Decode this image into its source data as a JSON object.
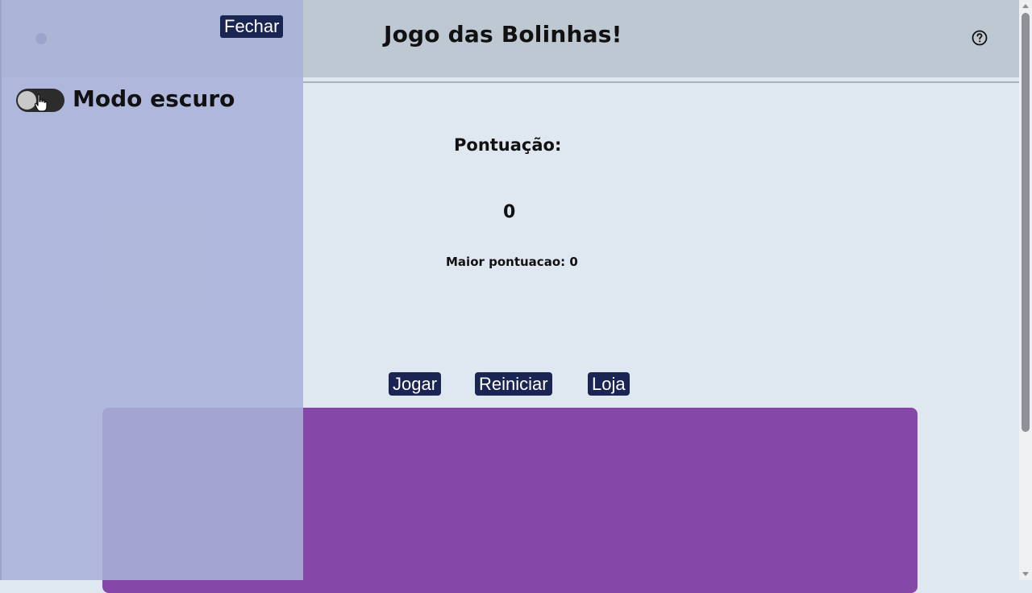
{
  "header": {
    "title": "Jogo das Bolinhas!",
    "help_icon": "help-circle-icon"
  },
  "score": {
    "label": "Pontuação:",
    "value": "0",
    "high_score_text": "Maior pontuacao: 0"
  },
  "controls": {
    "play_label": "Jogar",
    "restart_label": "Reiniciar",
    "shop_label": "Loja"
  },
  "side_panel": {
    "close_label": "Fechar",
    "dark_mode_label": "Modo escuro",
    "dark_mode_enabled": false
  },
  "colors": {
    "button_bg": "#1b2553",
    "game_board": "#8547a8",
    "header_bg": "#bdc8d2",
    "page_bg": "#dfe7f1",
    "side_panel_bg": "#a8b2d8"
  }
}
